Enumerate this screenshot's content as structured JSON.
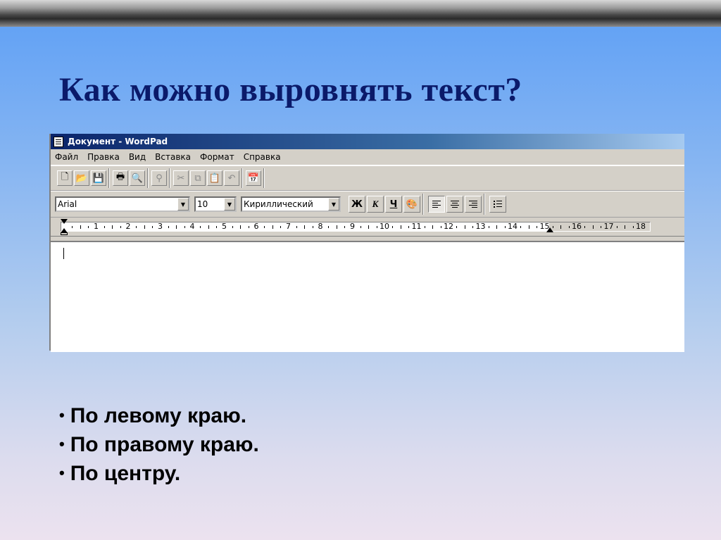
{
  "slide": {
    "title": "Как можно выровнять текст?",
    "bullets": [
      "По левому краю.",
      "По правому краю.",
      "По центру."
    ]
  },
  "wordpad": {
    "window_title": "Документ - WordPad",
    "menu": [
      "Файл",
      "Правка",
      "Вид",
      "Вставка",
      "Формат",
      "Справка"
    ],
    "toolbar_icons": [
      "new-icon",
      "open-icon",
      "save-icon",
      "print-icon",
      "print-preview-icon",
      "find-icon",
      "cut-icon",
      "copy-icon",
      "paste-icon",
      "undo-icon",
      "date-time-icon"
    ],
    "format": {
      "font": "Arial",
      "size": "10",
      "script": "Кириллический",
      "bold": "Ж",
      "italic": "К",
      "underline": "Ч",
      "alignment_selected": "left"
    },
    "ruler_numbers": [
      "1",
      "2",
      "3",
      "4",
      "5",
      "6",
      "7",
      "8",
      "9",
      "10",
      "11",
      "12",
      "13",
      "14",
      "15",
      "16",
      "17",
      "18"
    ],
    "colors": {
      "title_bar_start": "#0a246a",
      "title_bar_end": "#a6caf0",
      "face": "#d4d0c8"
    }
  },
  "colors": {
    "slide_title": "#0b1a6a",
    "background_top": "#5d9ff5",
    "background_bottom": "#ece2ef"
  }
}
